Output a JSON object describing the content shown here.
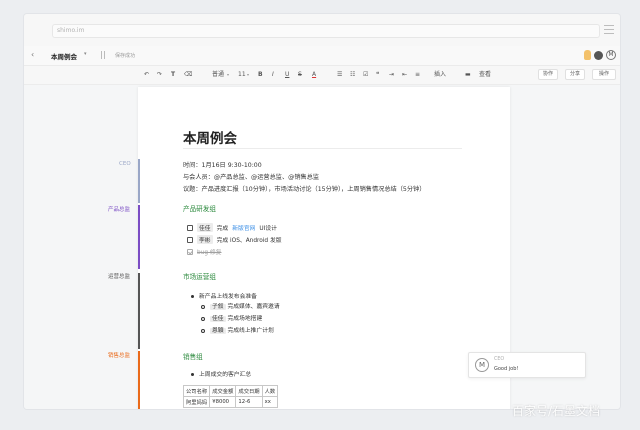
{
  "browser": {
    "url": "shimo.im"
  },
  "appbar": {
    "back_glyph": "‹",
    "doc_title": "本周例会",
    "title_caret": "▾",
    "save_status": "保存成功"
  },
  "toolbar": {
    "undo": "↶",
    "redo": "↷",
    "format_painter": "T",
    "clear_format": "⌫",
    "style_select": "普通",
    "size_select": "11",
    "bold": "B",
    "italic": "I",
    "underline": "U",
    "strike": "S",
    "text_color": "A",
    "ol": "☰",
    "ul": "☷",
    "check": "☑",
    "quote": "❝",
    "indent": "⇥",
    "outdent": "⇤",
    "align": "≡",
    "insert": "插入",
    "comment": "查看",
    "collab_btn": "协作",
    "share_btn": "分享",
    "ops_btn": "操作"
  },
  "sidebar": [
    {
      "label": "CEO",
      "color": "#9aa7c7"
    },
    {
      "label": "产品总监",
      "color": "#7b4dc4"
    },
    {
      "label": "运营总监",
      "color": "#555555"
    },
    {
      "label": "销售总监",
      "color": "#ea6a1a"
    }
  ],
  "doc": {
    "title": "本周例会",
    "time": "时间：1月16日 9:30-10:00",
    "attendees": "与会人员：@产品总监、@运营总监、@销售总监",
    "agenda": "议题：产品进度汇报（10分钟），市场活动讨论（15分钟），上周销售情况总结（5分钟）",
    "sections": {
      "product": {
        "heading": "产品研发组",
        "tasks": [
          {
            "who": "佳佳",
            "pre": "完成",
            "link": "新版官网",
            "post": "UI设计",
            "done": false
          },
          {
            "who": "李彬",
            "pre": "完成 iOS、Android 发版",
            "link": "",
            "post": "",
            "done": false
          },
          {
            "who": "",
            "pre": "bug 修复",
            "link": "",
            "post": "",
            "done": true
          }
        ]
      },
      "ops": {
        "heading": "市场运营组",
        "main": "新产品上线发布会准备",
        "subs": [
          {
            "who": "子叙",
            "text": "完成媒体、嘉宾邀请"
          },
          {
            "who": "佳佳",
            "text": "完成场地搭建"
          },
          {
            "who": "恩穎",
            "text": "完成线上推广计划"
          }
        ]
      },
      "sales": {
        "heading": "销售组",
        "main": "上周成交的客户汇总",
        "table_header": [
          "公司名称",
          "成交金额",
          "成交日期",
          "人数"
        ],
        "table_rows": [
          [
            "阿里妈妈",
            "¥8000",
            "12-6",
            "xx"
          ]
        ]
      }
    }
  },
  "chat": {
    "avatar": "M",
    "name": "CEO",
    "message": "Good job!"
  },
  "watermark": "百家号/石墨文档"
}
